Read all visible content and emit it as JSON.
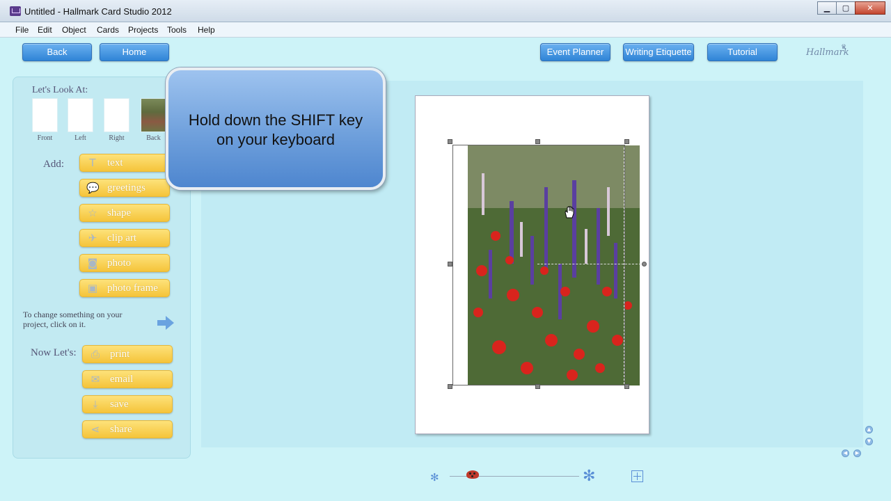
{
  "window": {
    "title": "Untitled - Hallmark Card Studio 2012",
    "controls": {
      "minimize": "▁",
      "maximize": "▢",
      "close": "✕"
    }
  },
  "menu": [
    "File",
    "Edit",
    "Object",
    "Cards",
    "Projects",
    "Tools",
    "Help"
  ],
  "nav": {
    "back": "Back",
    "home": "Home",
    "event_planner": "Event Planner",
    "writing_etiquette": "Writing Etiquette",
    "tutorial": "Tutorial",
    "logo": "Hallmark"
  },
  "left_panel": {
    "lets_look_at": "Let's Look At:",
    "views": [
      "Front",
      "Left",
      "Right",
      "Back"
    ],
    "add_label": "Add:",
    "add_items": [
      {
        "label": "text",
        "icon": "text-tool-icon"
      },
      {
        "label": "greetings",
        "icon": "speech-bubble-icon"
      },
      {
        "label": "shape",
        "icon": "star-icon"
      },
      {
        "label": "clip art",
        "icon": "bird-icon"
      },
      {
        "label": "photo",
        "icon": "camera-icon"
      },
      {
        "label": "photo frame",
        "icon": "picture-frame-icon"
      }
    ],
    "hint": "To change something on your project, click on it.",
    "now_lets_label": "Now Let's:",
    "now_items": [
      {
        "label": "print",
        "icon": "printer-icon"
      },
      {
        "label": "email",
        "icon": "envelope-icon"
      },
      {
        "label": "save",
        "icon": "save-icon"
      },
      {
        "label": "share",
        "icon": "share-icon"
      }
    ]
  },
  "tooltip": {
    "line1": "Hold down the SHIFT key",
    "line2": "on your keyboard"
  },
  "colors": {
    "accent_blue": "#2f84d6",
    "button_yellow": "#f5c43a",
    "panel_bg": "#c2eaf2",
    "canvas_bg": "#c1ebf4"
  }
}
